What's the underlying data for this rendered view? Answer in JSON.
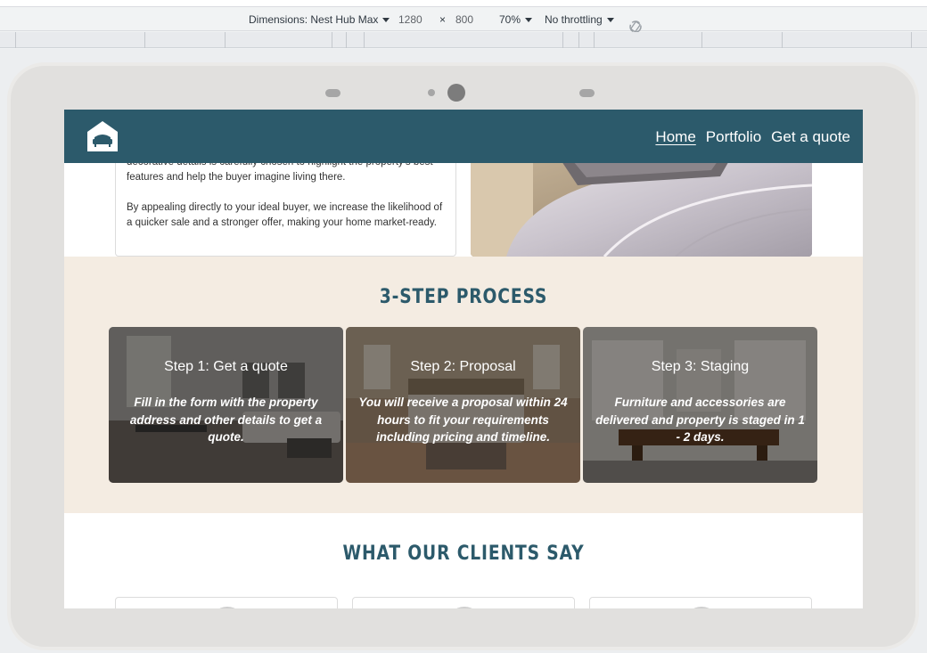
{
  "devtools": {
    "dimensions_label": "Dimensions: Nest Hub Max",
    "width": "1280",
    "times": "×",
    "height": "800",
    "zoom": "70%",
    "throttling": "No throttling"
  },
  "site": {
    "nav": {
      "links": [
        "Home",
        "Portfolio",
        "Get a quote"
      ],
      "active": "Home"
    },
    "intro": {
      "paragraph_1_fragment": "decorative details is carefully chosen to highlight the property's best features and help the buyer imagine living there.",
      "paragraph_2": "By appealing directly to your ideal buyer, we increase the likelihood of a quicker sale and a stronger offer, making your home market-ready."
    },
    "process": {
      "heading": "3-STEP PROCESS",
      "steps": [
        {
          "title": "Step 1: Get a quote",
          "text": "Fill in the form with the property address and other details to get a quote."
        },
        {
          "title": "Step 2: Proposal",
          "text": "You will receive a proposal within 24 hours to fit your requirements including pricing and timeline."
        },
        {
          "title": "Step 3: Staging",
          "text": "Furniture and accessories are delivered and property is staged in 1 - 2 days."
        }
      ]
    },
    "clients": {
      "heading": "WHAT OUR CLIENTS SAY"
    },
    "colors": {
      "brand": "#2c5a6b",
      "process_bg": "#f4ece2"
    }
  }
}
